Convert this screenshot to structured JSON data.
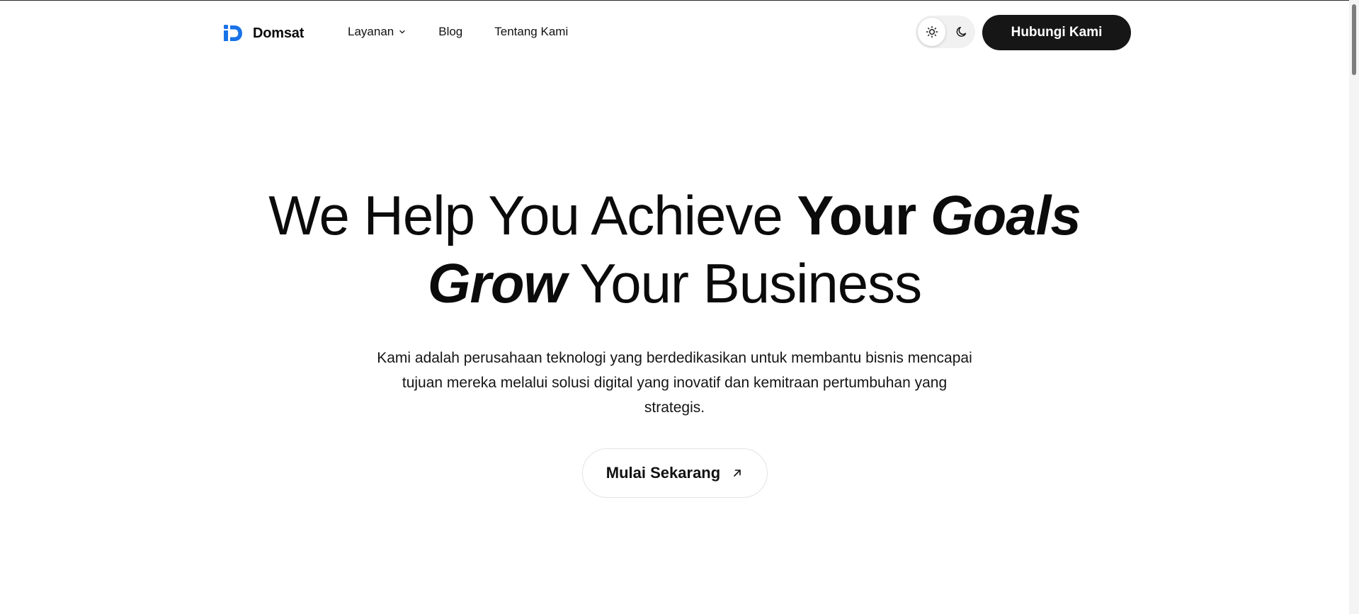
{
  "header": {
    "brand": "Domsat",
    "nav": [
      {
        "label": "Layanan",
        "has_dropdown": true
      },
      {
        "label": "Blog"
      },
      {
        "label": "Tentang Kami"
      }
    ],
    "theme_modes": [
      "light",
      "dark"
    ],
    "theme_active": "light",
    "cta_label": "Hubungi Kami"
  },
  "hero": {
    "headline_line1_regular": "We Help You Achieve ",
    "headline_line1_bold": "Your ",
    "headline_line1_bold_italic": "Goals",
    "headline_line2_bold_italic": "Grow",
    "headline_line2_regular": " Your Business",
    "subtitle": "Kami adalah perusahaan teknologi yang berdedikasikan untuk membantu bisnis mencapai tujuan mereka melalui solusi digital yang inovatif dan kemitraan pertumbuhan yang strategis.",
    "cta_label": "Mulai Sekarang"
  },
  "colors": {
    "brand_blue": "#1a73e8",
    "dark_button": "#161616",
    "text": "#0a0a0a"
  },
  "icons": [
    "domsat-logo-icon",
    "chevron-down-icon",
    "sun-icon",
    "moon-icon",
    "arrow-up-right-icon"
  ]
}
